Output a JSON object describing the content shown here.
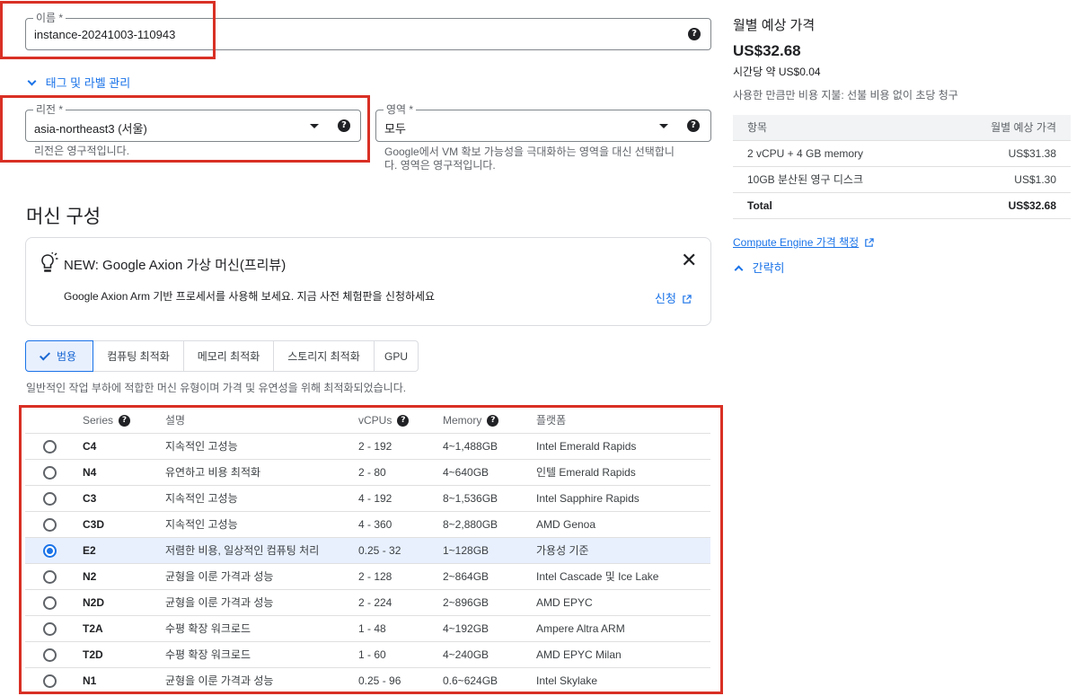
{
  "name_field": {
    "label": "이름 *",
    "value": "instance-20241003-110943"
  },
  "tags_link": "태그 및 라벨 관리",
  "region_field": {
    "label": "리전 *",
    "value": "asia-northeast3 (서울)",
    "hint": "리전은 영구적입니다."
  },
  "zone_field": {
    "label": "영역 *",
    "value": "모두",
    "hint_line1": "Google에서 VM 확보 가능성을 극대화하는 영역을 대신 선택합니",
    "hint_line2": "다. 영역은 영구적입니다."
  },
  "machine_config": {
    "title": "머신 구성"
  },
  "notice": {
    "title": "NEW: Google Axion 가상 머신(프리뷰)",
    "body": "Google Axion Arm 기반 프로세서를 사용해 보세요. 지금 사전 체험판을 신청하세요",
    "apply_link": "신청",
    "icon": "lightbulb-icon"
  },
  "machine_tabs": [
    {
      "label": "범용",
      "selected": true
    },
    {
      "label": "컴퓨팅 최적화",
      "selected": false
    },
    {
      "label": "메모리 최적화",
      "selected": false
    },
    {
      "label": "스토리지 최적화",
      "selected": false
    },
    {
      "label": "GPU",
      "selected": false
    }
  ],
  "tab_description": "일반적인 작업 부하에 적합한 머신 유형이며 가격 및 유연성을 위해 최적화되었습니다.",
  "series_table": {
    "headers": {
      "series": "Series",
      "description": "설명",
      "vcpus": "vCPUs",
      "memory": "Memory",
      "platform": "플랫폼"
    },
    "rows": [
      {
        "series": "C4",
        "description": "지속적인 고성능",
        "vcpus": "2 - 192",
        "memory": "4~1,488GB",
        "platform": "Intel Emerald Rapids",
        "selected": false
      },
      {
        "series": "N4",
        "description": "유연하고 비용 최적화",
        "vcpus": "2 - 80",
        "memory": "4~640GB",
        "platform": "인텔 Emerald Rapids",
        "selected": false
      },
      {
        "series": "C3",
        "description": "지속적인 고성능",
        "vcpus": "4 - 192",
        "memory": "8~1,536GB",
        "platform": "Intel Sapphire Rapids",
        "selected": false
      },
      {
        "series": "C3D",
        "description": "지속적인 고성능",
        "vcpus": "4 - 360",
        "memory": "8~2,880GB",
        "platform": "AMD Genoa",
        "selected": false
      },
      {
        "series": "E2",
        "description": "저렴한 비용, 일상적인 컴퓨팅 처리",
        "vcpus": "0.25 - 32",
        "memory": "1~128GB",
        "platform": "가용성 기준",
        "selected": true
      },
      {
        "series": "N2",
        "description": "균형을 이룬 가격과 성능",
        "vcpus": "2 - 128",
        "memory": "2~864GB",
        "platform": "Intel Cascade 및 Ice Lake",
        "selected": false
      },
      {
        "series": "N2D",
        "description": "균형을 이룬 가격과 성능",
        "vcpus": "2 - 224",
        "memory": "2~896GB",
        "platform": "AMD EPYC",
        "selected": false
      },
      {
        "series": "T2A",
        "description": "수평 확장 워크로드",
        "vcpus": "1 - 48",
        "memory": "4~192GB",
        "platform": "Ampere Altra ARM",
        "selected": false
      },
      {
        "series": "T2D",
        "description": "수평 확장 워크로드",
        "vcpus": "1 - 60",
        "memory": "4~240GB",
        "platform": "AMD EPYC Milan",
        "selected": false
      },
      {
        "series": "N1",
        "description": "균형을 이룬 가격과 성능",
        "vcpus": "0.25 - 96",
        "memory": "0.6~624GB",
        "platform": "Intel Skylake",
        "selected": false
      }
    ]
  },
  "pricing": {
    "title": "월별 예상 가격",
    "monthly": "US$32.68",
    "hourly_prefix": "시간당 약",
    "hourly": "US$0.04",
    "note": "사용한 만큼만 비용 지불: 선불 비용 없이 초당 청구",
    "header_item": "항목",
    "header_cost": "월별 예상 가격",
    "items": [
      {
        "label": "2 vCPU + 4 GB memory",
        "cost": "US$31.38"
      },
      {
        "label": "10GB 분산된 영구 디스크",
        "cost": "US$1.30"
      }
    ],
    "total_label": "Total",
    "total_cost": "US$32.68",
    "pricing_link": "Compute Engine 가격 책정",
    "collapse_link": "간략히"
  },
  "colors": {
    "accent": "#1a73e8",
    "highlight": "#d93025",
    "selected_row": "#e8f0fe"
  }
}
